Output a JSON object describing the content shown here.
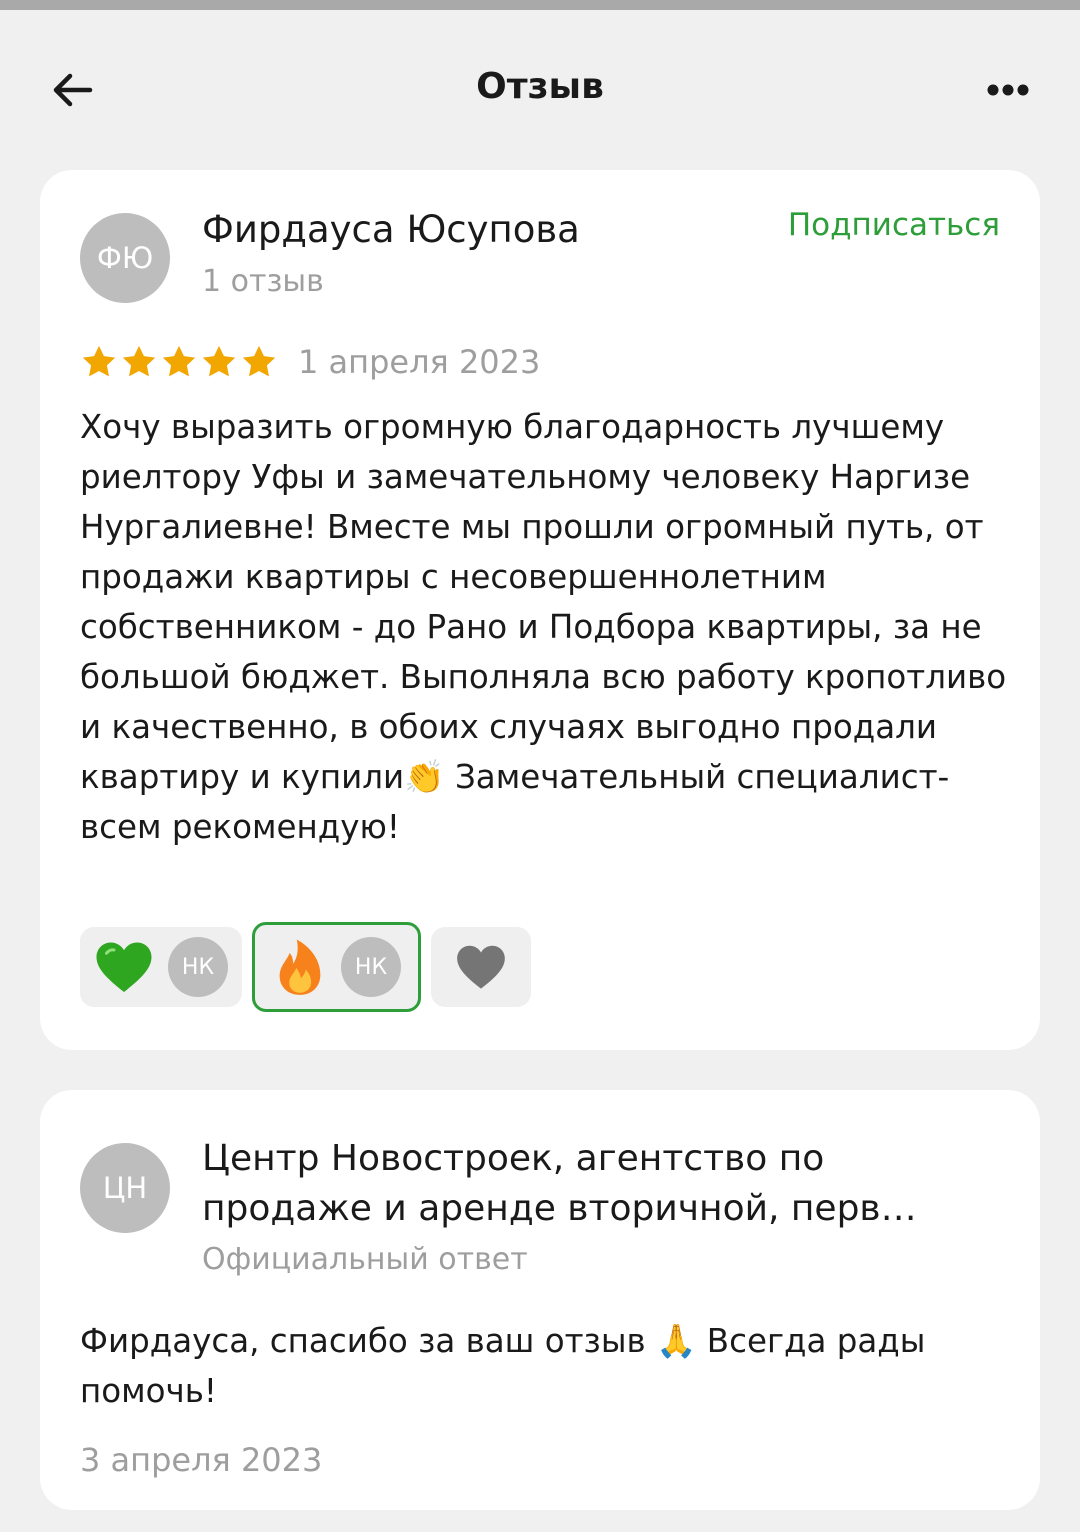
{
  "header": {
    "title": "Отзыв",
    "back_icon": "arrow-left-icon",
    "more_icon": "more-horizontal-icon"
  },
  "review": {
    "author": {
      "initials": "ФЮ",
      "name": "Фирдауса Юсупова",
      "meta": "1 отзыв"
    },
    "subscribe_label": "Подписаться",
    "rating": 5,
    "rating_max": 5,
    "date": "1 апреля 2023",
    "text": "Хочу выразить огромную благодарность лучшему риелтору Уфы и замечательному человеку Наргизе Нургалиевне! Вместе мы прошли огромный путь, от продажи квартиры с несовершеннолетним собственником - до Рано и Подбора квартиры, за не большой бюджет. Выполняла всю работу кропотливо и качественно, в обоих случаях выгодно продали квартиру и купили👏 Замечательный специалист- всем рекомендую!",
    "reactions": [
      {
        "icon": "green-heart-icon",
        "user_initials": "НК",
        "selected": false
      },
      {
        "icon": "fire-icon",
        "user_initials": "НК",
        "selected": true
      },
      {
        "icon": "heart-icon",
        "user_initials": "",
        "selected": false
      }
    ]
  },
  "reply": {
    "author": {
      "initials": "ЦН",
      "name": "Центр Новостроек, агентство по продаже и аренде вторичной, перв…",
      "meta": "Официальный ответ"
    },
    "text": "Фирдауса, спасибо за ваш отзыв 🙏 Всегда рады помочь!",
    "date": "3 апреля 2023"
  },
  "colors": {
    "accent_green": "#2e9e3a",
    "star": "#f2a600",
    "muted_text": "#9e9e9e",
    "avatar_bg": "#bdbdbd",
    "background": "#f0f0f0"
  }
}
